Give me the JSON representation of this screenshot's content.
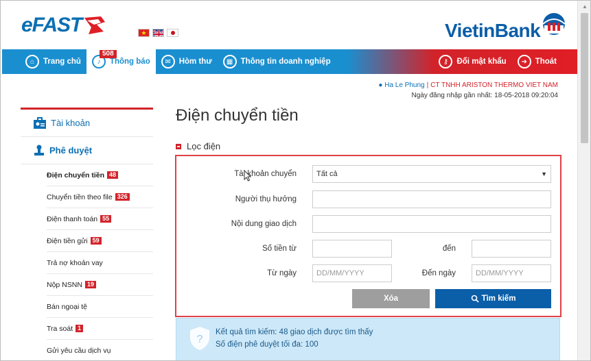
{
  "header": {
    "efast_logo": "eFAST",
    "vietinbank_logo": "VietinBank",
    "flags": [
      "vn",
      "uk",
      "jp"
    ]
  },
  "nav": {
    "items": [
      {
        "label": "Trang chủ",
        "icon": "home-icon"
      },
      {
        "label": "Thông báo",
        "icon": "bell-icon",
        "badge": "508"
      },
      {
        "label": "Hòm thư",
        "icon": "mail-icon"
      },
      {
        "label": "Thông tin doanh nghiệp",
        "icon": "building-icon"
      }
    ],
    "right": [
      {
        "label": "Đổi mật khẩu",
        "icon": "key-icon"
      },
      {
        "label": "Thoát",
        "icon": "logout-icon"
      }
    ]
  },
  "user": {
    "name": "Ha Le Phung",
    "company": "CT TNHH ARISTON THERMO VIET NAM",
    "last_login": "Ngày đăng nhập gần nhất: 18-05-2018 09:20:04"
  },
  "sidebar": {
    "account_label": "Tài khoản",
    "approve_label": "Phê duyệt",
    "items": [
      {
        "label": "Điện chuyển tiền",
        "count": "48"
      },
      {
        "label": "Chuyển tiền theo file",
        "count": "326"
      },
      {
        "label": "Điện thanh toán",
        "count": "55"
      },
      {
        "label": "Điện tiền gửi",
        "count": "59"
      },
      {
        "label": "Trả nợ khoản vay",
        "count": ""
      },
      {
        "label": "Nộp NSNN",
        "count": "19"
      },
      {
        "label": "Bán ngoại tệ",
        "count": ""
      },
      {
        "label": "Tra soát",
        "count": "1"
      },
      {
        "label": "Gửi yêu cầu dịch vụ",
        "count": ""
      }
    ]
  },
  "main": {
    "title": "Điện chuyển tiền",
    "filter_title": "Lọc điện",
    "fields": {
      "account_label": "Tài khoản chuyển",
      "account_value": "Tất cả",
      "beneficiary_label": "Người thụ hưởng",
      "content_label": "Nội dung giao dịch",
      "amount_from_label": "Số tiền từ",
      "amount_to_label": "đến",
      "date_from_label": "Từ ngày",
      "date_to_label": "Đến ngày",
      "date_placeholder": "DD/MM/YYYY"
    },
    "clear_label": "Xóa",
    "search_label": "Tìm kiếm",
    "result_line1": "Kết quả tìm kiếm: 48 giao dịch được tìm thấy",
    "result_line2": "Số điện phê duyệt tối đa: 100"
  },
  "colors": {
    "brand_blue": "#1a8fd0",
    "brand_red": "#d2232a",
    "button_blue": "#0b5ea8"
  }
}
